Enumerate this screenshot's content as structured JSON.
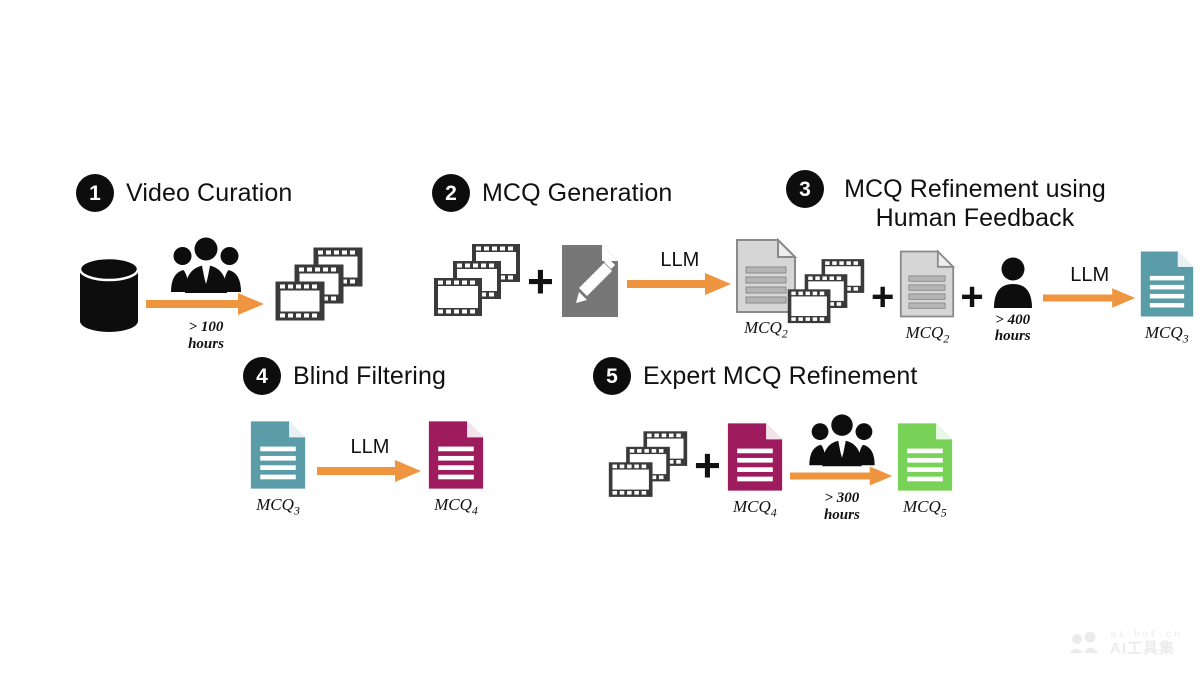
{
  "figure": {
    "type": "pipeline-diagram",
    "background": "#ffffff",
    "accent_arrow": "#F0953F"
  },
  "palette": {
    "black": "#0d0d0d",
    "orange": "#F0953F",
    "gray_doc": "#D6D6D6",
    "gray_prompt": "#777777",
    "teal": "#5A9CA8",
    "magenta": "#9E1C5E",
    "green": "#78D257",
    "film": "#3a3a3a"
  },
  "steps": [
    {
      "number": "1",
      "title": "Video Curation",
      "inputs": [
        {
          "icon": "database-cylinder-icon",
          "caption": ""
        }
      ],
      "arrow": {
        "label": "",
        "sub": "> 100\nhours",
        "over_icon": "people-group-icon"
      },
      "output": {
        "icon": "film-strips-icon",
        "caption": "",
        "color": ""
      }
    },
    {
      "number": "2",
      "title": "MCQ Generation",
      "inputs": [
        {
          "icon": "film-strips-icon",
          "caption": ""
        },
        {
          "icon": "prompt-document-pencil-icon",
          "caption": ""
        }
      ],
      "arrow": {
        "label": "LLM",
        "sub": "",
        "over_icon": ""
      },
      "output": {
        "icon": "document-icon",
        "caption": "MCQ",
        "sub": "2",
        "color": "#D6D6D6"
      }
    },
    {
      "number": "3",
      "title": "MCQ Refinement using\nHuman Feedback",
      "inputs": [
        {
          "icon": "film-strips-icon",
          "caption": ""
        },
        {
          "icon": "document-icon",
          "caption": "MCQ",
          "sub": "2",
          "color": "#D6D6D6"
        },
        {
          "icon": "person-icon",
          "caption": "> 400\nhours"
        }
      ],
      "arrow": {
        "label": "LLM",
        "sub": "",
        "over_icon": ""
      },
      "output": {
        "icon": "document-icon",
        "caption": "MCQ",
        "sub": "3",
        "color": "#5A9CA8"
      }
    },
    {
      "number": "4",
      "title": "Blind Filtering",
      "inputs": [
        {
          "icon": "document-icon",
          "caption": "MCQ",
          "sub": "3",
          "color": "#5A9CA8"
        }
      ],
      "arrow": {
        "label": "LLM",
        "sub": "",
        "over_icon": ""
      },
      "output": {
        "icon": "document-icon",
        "caption": "MCQ",
        "sub": "4",
        "color": "#9E1C5E"
      }
    },
    {
      "number": "5",
      "title": "Expert MCQ Refinement",
      "inputs": [
        {
          "icon": "film-strips-icon",
          "caption": ""
        },
        {
          "icon": "document-icon",
          "caption": "MCQ",
          "sub": "4",
          "color": "#9E1C5E"
        }
      ],
      "arrow": {
        "label": "",
        "sub": "> 300\nhours",
        "over_icon": "people-group-icon"
      },
      "output": {
        "icon": "document-icon",
        "caption": "MCQ",
        "sub": "5",
        "color": "#78D257"
      }
    }
  ],
  "labels": {
    "step1": {
      "num": "1",
      "title": "Video Curation",
      "hours": "> 100\nhours"
    },
    "step2": {
      "num": "2",
      "title": "MCQ Generation",
      "llm": "LLM",
      "out": "MCQ",
      "out_sub": "2"
    },
    "step3": {
      "num": "3",
      "title": "MCQ Refinement using\nHuman Feedback",
      "llm": "LLM",
      "in_doc": "MCQ",
      "in_doc_sub": "2",
      "hours": "> 400\nhours",
      "out": "MCQ",
      "out_sub": "3"
    },
    "step4": {
      "num": "4",
      "title": "Blind Filtering",
      "llm": "LLM",
      "in_doc": "MCQ",
      "in_doc_sub": "3",
      "out": "MCQ",
      "out_sub": "4"
    },
    "step5": {
      "num": "5",
      "title": "Expert MCQ Refinement",
      "hours": "> 300\nhours",
      "in_doc": "MCQ",
      "in_doc_sub": "4",
      "out": "MCQ",
      "out_sub": "5"
    },
    "plus": "+"
  },
  "watermark": {
    "top": "ai-bot.cn",
    "bottom": "AI工具集"
  }
}
